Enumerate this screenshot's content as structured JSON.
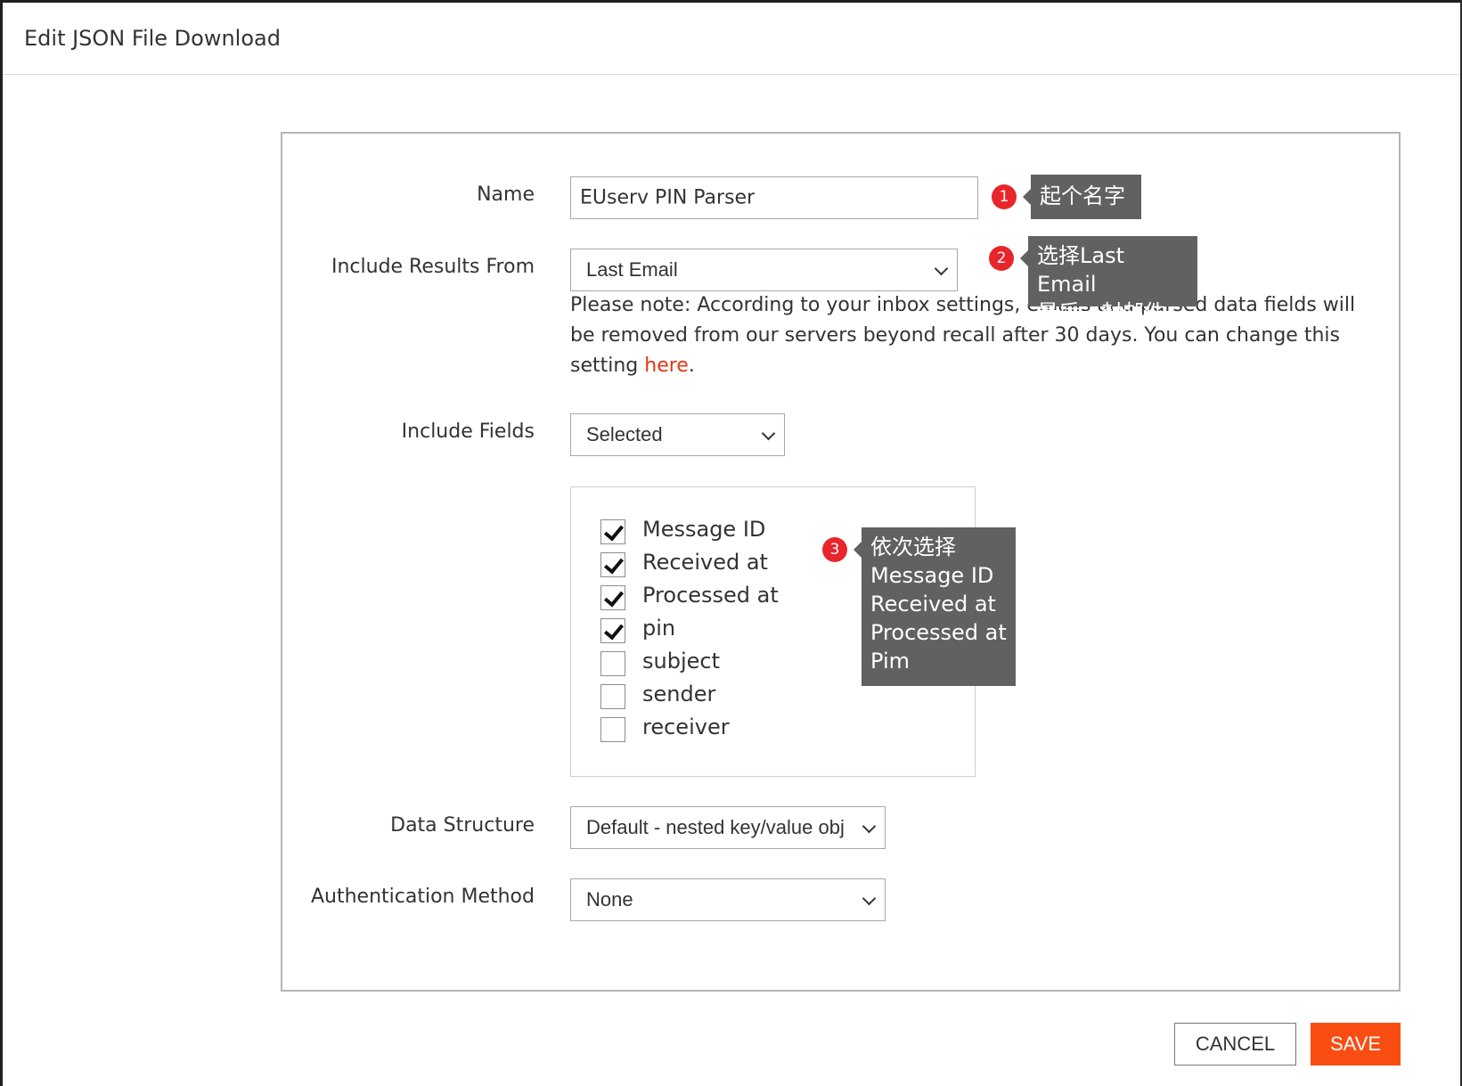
{
  "dialog": {
    "title": "Edit JSON File Download"
  },
  "form": {
    "name_label": "Name",
    "name_value": "EUserv PIN Parser",
    "include_results_label": "Include Results From",
    "include_results_value": "Last Email",
    "note_text": "Please note: According to your inbox settings, emails and parsed data fields will be removed from our servers beyond recall after 30 days. You can change this setting ",
    "note_link": "here",
    "note_end": ".",
    "include_fields_label": "Include Fields",
    "include_fields_value": "Selected",
    "fields": [
      {
        "label": "Message ID",
        "checked": true
      },
      {
        "label": "Received at",
        "checked": true
      },
      {
        "label": "Processed at",
        "checked": true
      },
      {
        "label": "pin",
        "checked": true
      },
      {
        "label": "subject",
        "checked": false
      },
      {
        "label": "sender",
        "checked": false
      },
      {
        "label": "receiver",
        "checked": false
      }
    ],
    "data_structure_label": "Data Structure",
    "data_structure_value": "Default - nested key/value obj",
    "auth_label": "Authentication Method",
    "auth_value": "None"
  },
  "buttons": {
    "cancel": "CANCEL",
    "save": "SAVE"
  },
  "colors": {
    "accent": "#fa4d12",
    "link": "#e63312",
    "annotation_bg": "#616161",
    "badge": "#e8252b"
  },
  "annotations": [
    {
      "number": "1",
      "text": "起个名字"
    },
    {
      "number": "2",
      "text": "选择Last Email\n最后一封邮件"
    },
    {
      "number": "3",
      "text": "依次选择\nMessage ID\nReceived at\nProcessed at\nPim"
    }
  ]
}
